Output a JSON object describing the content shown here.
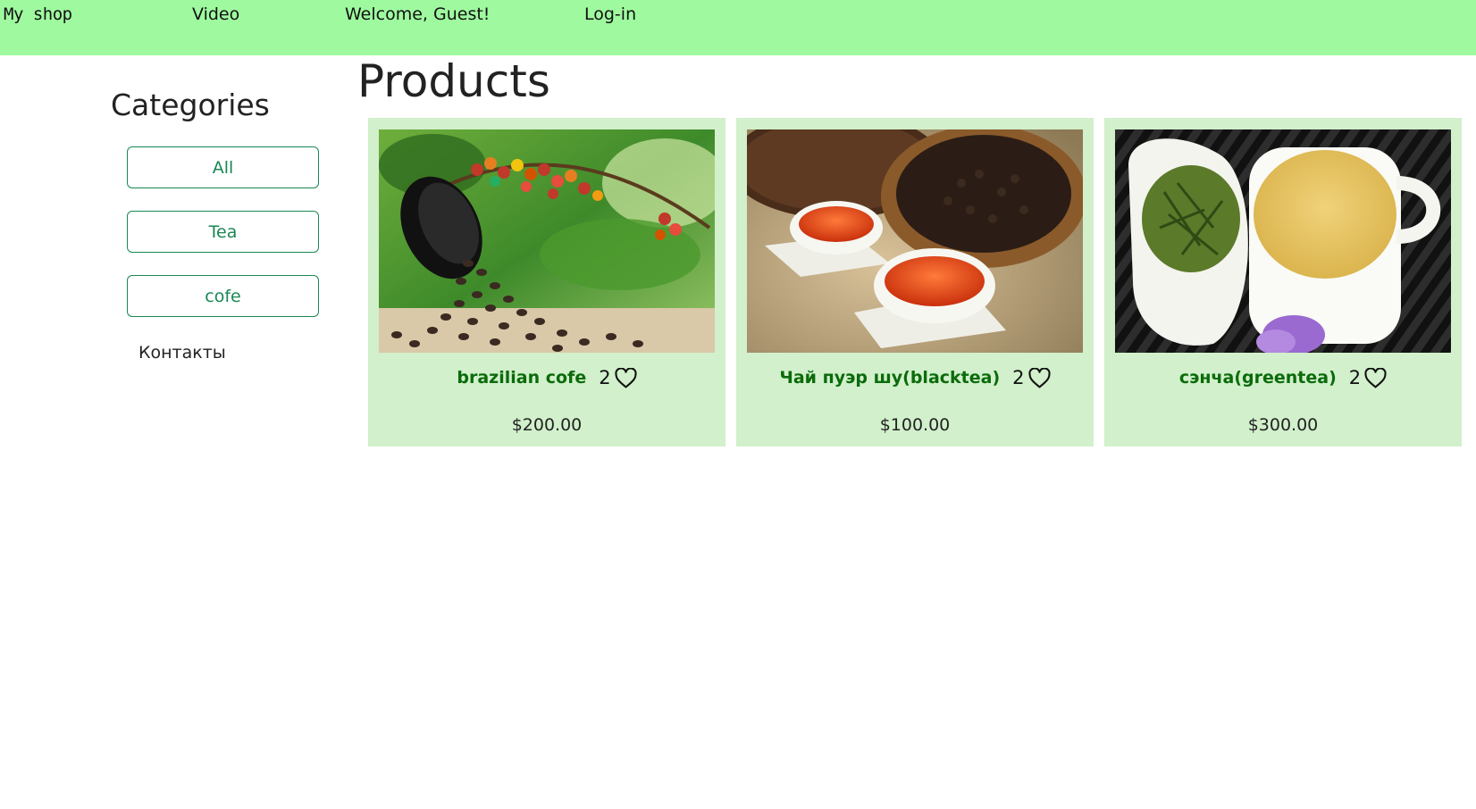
{
  "nav": {
    "brand": "My shop",
    "video": "Video",
    "welcome": "Welcome, Guest!",
    "login": "Log-in",
    "background_color": "#9ffa9f"
  },
  "sidebar": {
    "title": "Categories",
    "buttons": [
      {
        "label": "All"
      },
      {
        "label": "Tea"
      },
      {
        "label": "cofe"
      }
    ],
    "contacts": "Контакты",
    "accent_color": "#198754"
  },
  "main": {
    "title": "Products",
    "card_color": "#d1f0cb",
    "products": [
      {
        "name": "brazilian cofe",
        "likes": "2",
        "price": "$200.00",
        "image": "coffee-beans-photo",
        "icon": "heart-icon"
      },
      {
        "name": "Чай пуэр шу(blacktea)",
        "likes": "2",
        "price": "$100.00",
        "image": "puerh-tea-photo",
        "icon": "heart-icon"
      },
      {
        "name": "сэнча(greentea)",
        "likes": "2",
        "price": "$300.00",
        "image": "sencha-tea-photo",
        "icon": "heart-icon"
      }
    ]
  }
}
